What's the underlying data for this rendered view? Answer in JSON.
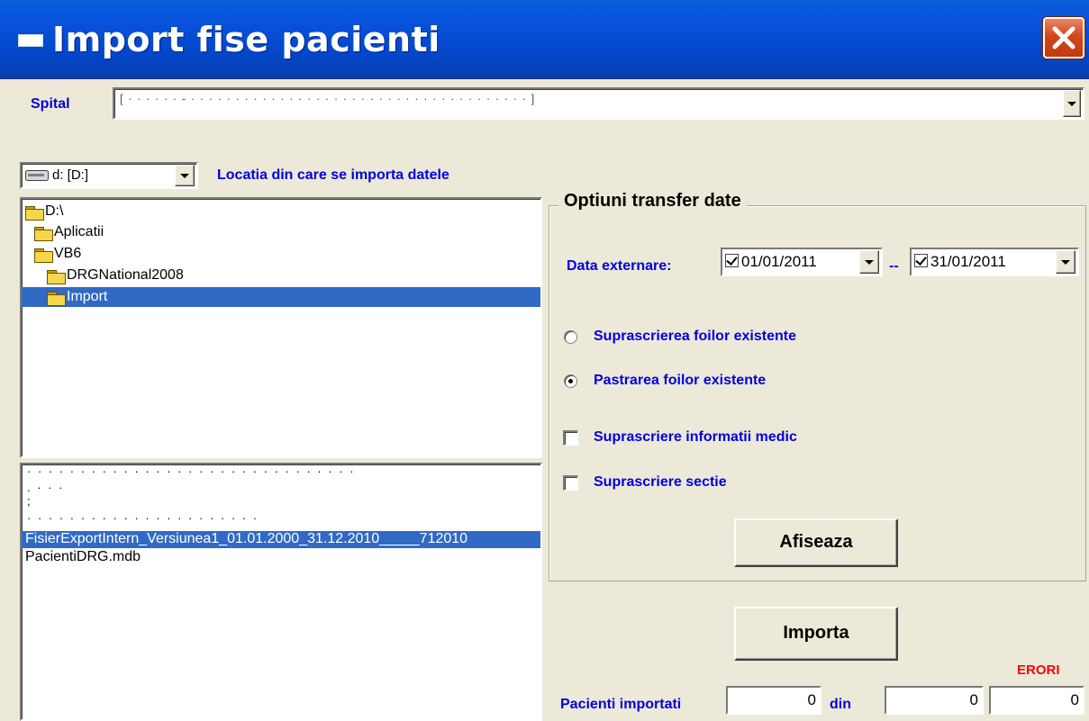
{
  "window": {
    "title": "Import fise pacienti"
  },
  "spital": {
    "label": "Spital"
  },
  "drive": {
    "value": "d: [D:]",
    "location_label": "Locatia din care se importa datele"
  },
  "directories": [
    {
      "label": "D:\\",
      "indent": 0,
      "selected": false
    },
    {
      "label": "Aplicatii",
      "indent": 1,
      "selected": false
    },
    {
      "label": "VB6",
      "indent": 1,
      "selected": false
    },
    {
      "label": "DRGNational2008",
      "indent": 2,
      "selected": false
    },
    {
      "label": "Import",
      "indent": 2,
      "selected": true
    }
  ],
  "files": {
    "selected": "FisierExportIntern_Versiunea1_01.01.2000_31.12.2010_____712010",
    "items": [
      "PacientiDRG.mdb"
    ]
  },
  "options": {
    "group_title": "Optiuni transfer date",
    "date_label": "Data externare:",
    "date_from": "01/01/2011",
    "date_separator": "--",
    "date_to": "31/01/2011",
    "radio_overwrite": {
      "label": "Suprascrierea foilor existente",
      "checked": false
    },
    "radio_keep": {
      "label": "Pastrarea foilor existente",
      "checked": true
    },
    "check_medic": {
      "label": "Suprascriere informatii medic",
      "checked": false
    },
    "check_sectie": {
      "label": "Suprascriere sectie",
      "checked": false
    },
    "show_button": "Afiseaza"
  },
  "import": {
    "button": "Importa",
    "patients_label": "Pacienti importati",
    "imported": "0",
    "of_label": "din",
    "total": "0",
    "errors_label": "ERORI",
    "errors": "0"
  },
  "colors": {
    "label_blue": "#0000e0",
    "selection": "#316ac5",
    "errors_red": "#ff0000",
    "titlebar": "#0346c9"
  }
}
